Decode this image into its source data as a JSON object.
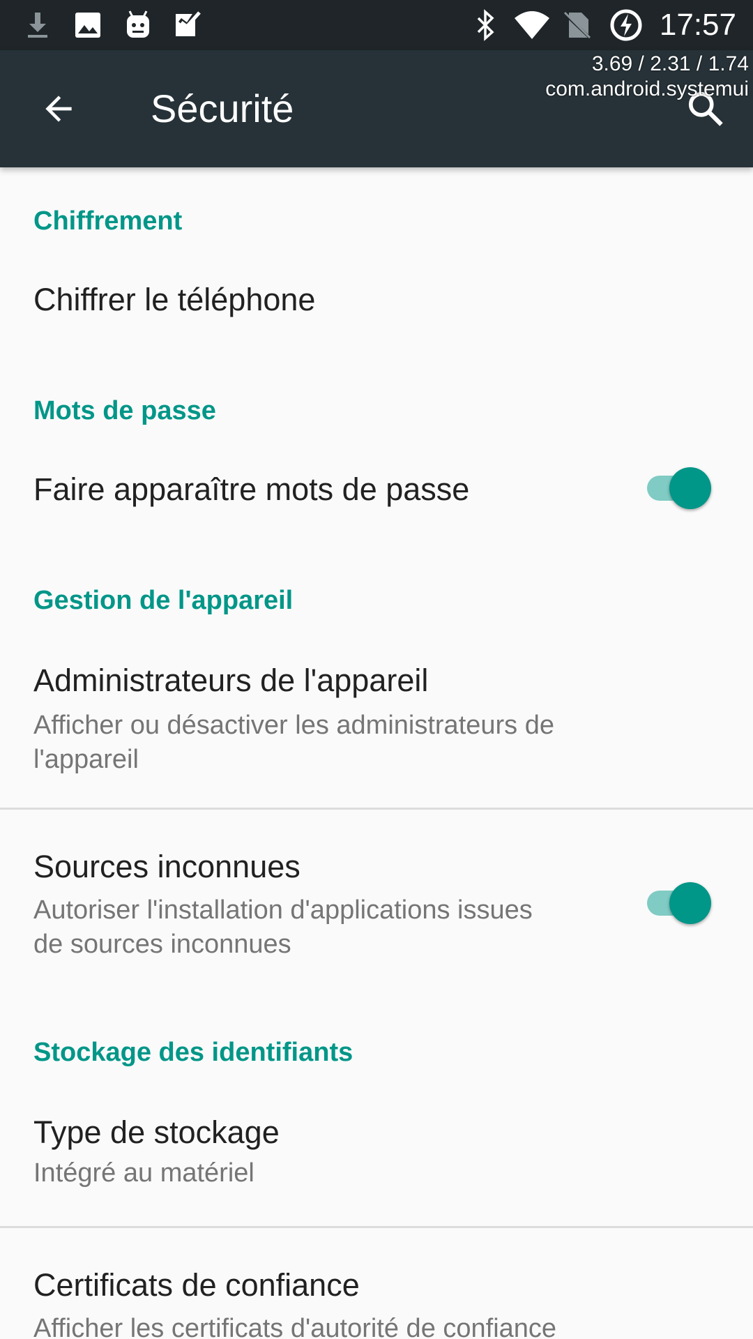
{
  "status_bar": {
    "time": "17:57",
    "left_icons": [
      "download-icon",
      "image-icon",
      "android-icon",
      "task-check-icon"
    ],
    "right_icons": [
      "bluetooth-icon",
      "wifi-icon",
      "no-sim-icon",
      "battery-charging-icon"
    ]
  },
  "debug_overlay": {
    "load": "3.69 / 2.31 / 1.74",
    "package": "com.android.systemui"
  },
  "toolbar": {
    "title": "Sécurité",
    "back_icon": "arrow-back-icon",
    "search_icon": "search-icon",
    "background": "#263238"
  },
  "colors": {
    "accent": "#009688",
    "accent_light": "#80cbc4",
    "primary_text": "#212121",
    "secondary_text": "#757575"
  },
  "sections": {
    "encryption": {
      "header": "Chiffrement",
      "items": [
        {
          "title": "Chiffrer le téléphone"
        }
      ]
    },
    "passwords": {
      "header": "Mots de passe",
      "items": [
        {
          "title": "Faire apparaître mots de passe",
          "switch_on": true
        }
      ]
    },
    "device_admin": {
      "header": "Gestion de l'appareil",
      "items": [
        {
          "title": "Administrateurs de l'appareil",
          "summary": "Afficher ou désactiver les administrateurs de l'appareil"
        },
        {
          "title": "Sources inconnues",
          "summary": "Autoriser l'installation d'applications issues de sources inconnues",
          "switch_on": true
        }
      ]
    },
    "credential_storage": {
      "header": "Stockage des identifiants",
      "items": [
        {
          "title": "Type de stockage",
          "summary": "Intégré au matériel"
        },
        {
          "title": "Certificats de confiance",
          "summary": "Afficher les certificats d'autorité de confiance"
        }
      ]
    }
  }
}
